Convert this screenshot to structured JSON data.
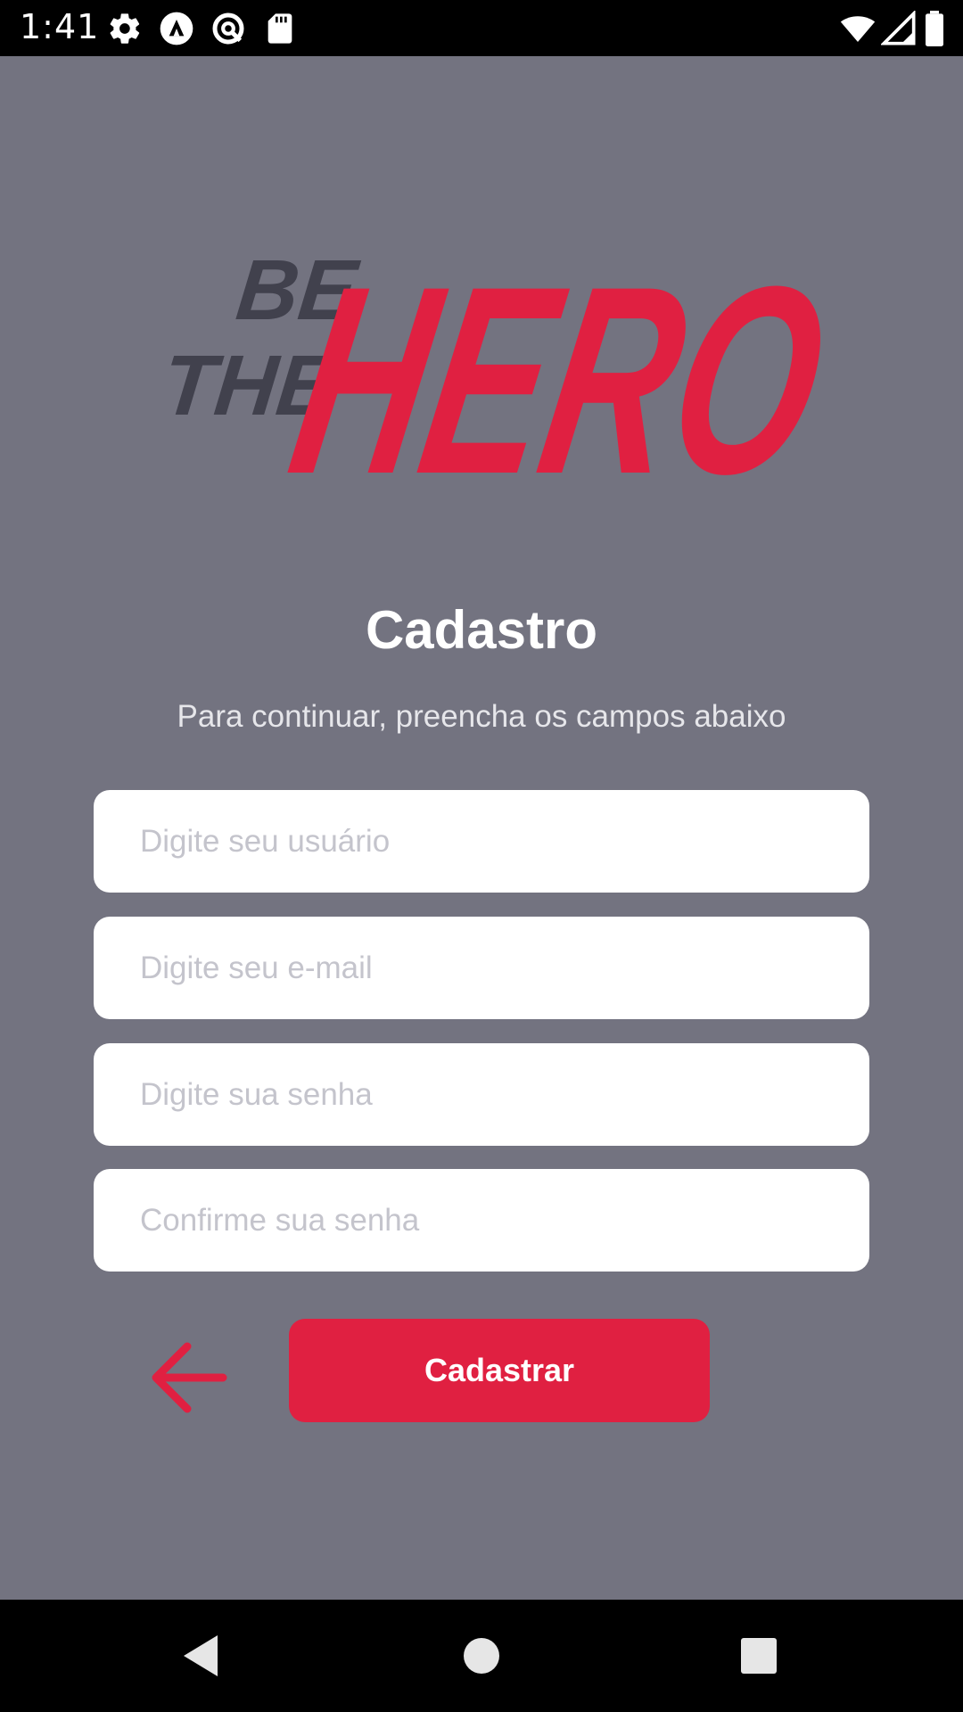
{
  "status_bar": {
    "time": "1:41",
    "icons": [
      "gear-icon",
      "launcher-icon",
      "data-saver-icon",
      "sd-card-icon",
      "wifi-icon",
      "signal-icon",
      "battery-icon"
    ]
  },
  "logo": {
    "line1": "BE",
    "line2": "THE",
    "hero": "HERO",
    "colors": {
      "dark": "#41414d",
      "brand": "#e02041"
    }
  },
  "header": {
    "title": "Cadastro",
    "subtitle": "Para continuar, preencha os campos abaixo"
  },
  "form": {
    "username": {
      "value": "",
      "placeholder": "Digite seu usuário"
    },
    "email": {
      "value": "",
      "placeholder": "Digite seu e-mail"
    },
    "password": {
      "value": "",
      "placeholder": "Digite sua senha"
    },
    "confirm_password": {
      "value": "",
      "placeholder": "Confirme sua senha"
    },
    "submit_label": "Cadastrar"
  },
  "colors": {
    "background": "#737380",
    "accent": "#e02041",
    "input_background": "#ffffff"
  },
  "nav_bar": {
    "icons": [
      "back-triangle-icon",
      "home-circle-icon",
      "recents-square-icon"
    ]
  }
}
